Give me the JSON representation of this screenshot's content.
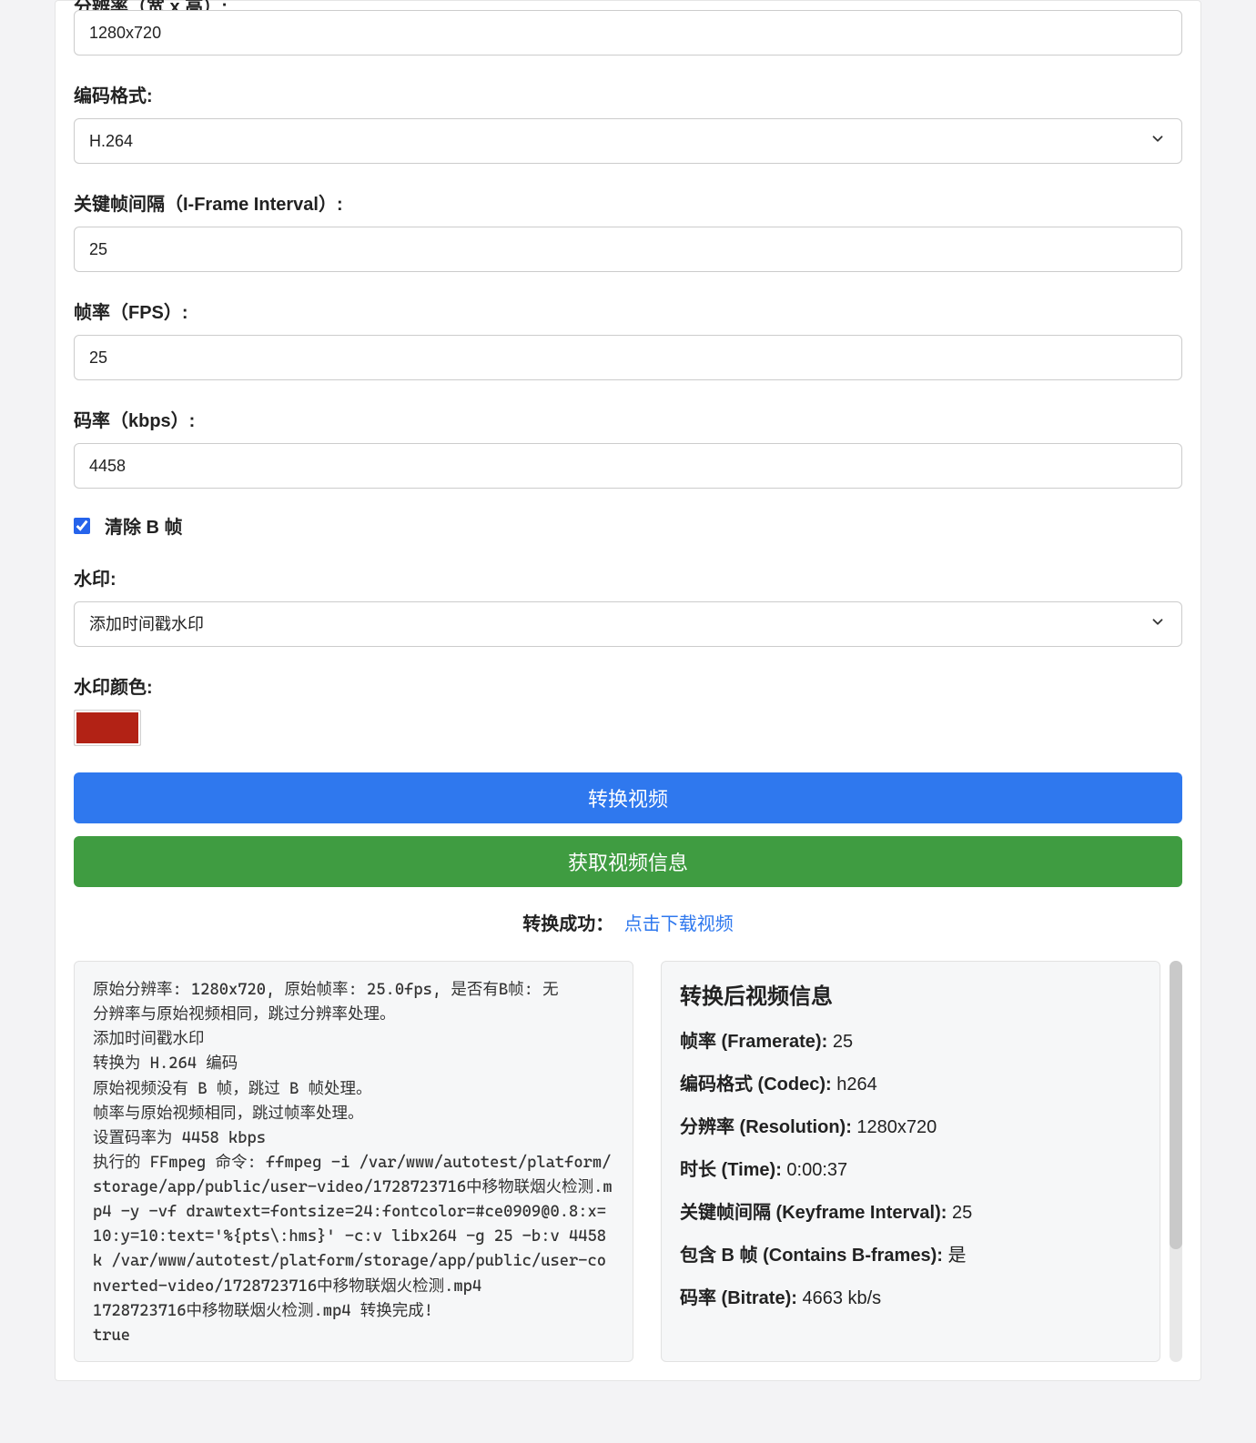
{
  "form": {
    "resolution": {
      "label": "分辨率（宽 x 高）:",
      "value": "1280x720"
    },
    "codec": {
      "label": "编码格式:",
      "value": "H.264"
    },
    "iframe_interval": {
      "label": "关键帧间隔（I-Frame Interval）:",
      "value": "25"
    },
    "fps": {
      "label": "帧率（FPS）:",
      "value": "25"
    },
    "bitrate": {
      "label": "码率（kbps）:",
      "value": "4458"
    },
    "remove_bframes": {
      "label": "清除 B 帧",
      "checked": true
    },
    "watermark": {
      "label": "水印:",
      "value": "添加时间戳水印"
    },
    "watermark_color": {
      "label": "水印颜色:",
      "value": "#b22215"
    }
  },
  "buttons": {
    "convert": "转换视频",
    "get_info": "获取视频信息"
  },
  "success": {
    "label": "转换成功：",
    "link": "点击下载视频"
  },
  "log_text": "原始分辨率: 1280x720, 原始帧率: 25.0fps, 是否有B帧: 无\n分辨率与原始视频相同，跳过分辨率处理。\n添加时间戳水印\n转换为 H.264 编码\n原始视频没有 B 帧，跳过 B 帧处理。\n帧率与原始视频相同，跳过帧率处理。\n设置码率为 4458 kbps\n执行的 FFmpeg 命令: ffmpeg -i /var/www/autotest/platform/storage/app/public/user-video/1728723716中移物联烟火检测.mp4 -y -vf drawtext=fontsize=24:fontcolor=#ce0909@0.8:x=10:y=10:text='%{pts\\:hms}' -c:v libx264 -g 25 -b:v 4458k /var/www/autotest/platform/storage/app/public/user-converted-video/1728723716中移物联烟火检测.mp4\n1728723716中移物联烟火检测.mp4 转换完成!\ntrue",
  "info": {
    "title": "转换后视频信息",
    "framerate": {
      "k": "帧率 (Framerate):",
      "v": " 25"
    },
    "codec": {
      "k": "编码格式 (Codec):",
      "v": " h264"
    },
    "resolution": {
      "k": "分辨率 (Resolution):",
      "v": " 1280x720"
    },
    "time": {
      "k": "时长 (Time):",
      "v": " 0:00:37"
    },
    "keyframe": {
      "k": "关键帧间隔 (Keyframe Interval):",
      "v": " 25"
    },
    "bframes": {
      "k": "包含 B 帧 (Contains B-frames):",
      "v": " 是"
    },
    "bitrate": {
      "k": "码率 (Bitrate):",
      "v": " 4663 kb/s"
    }
  }
}
